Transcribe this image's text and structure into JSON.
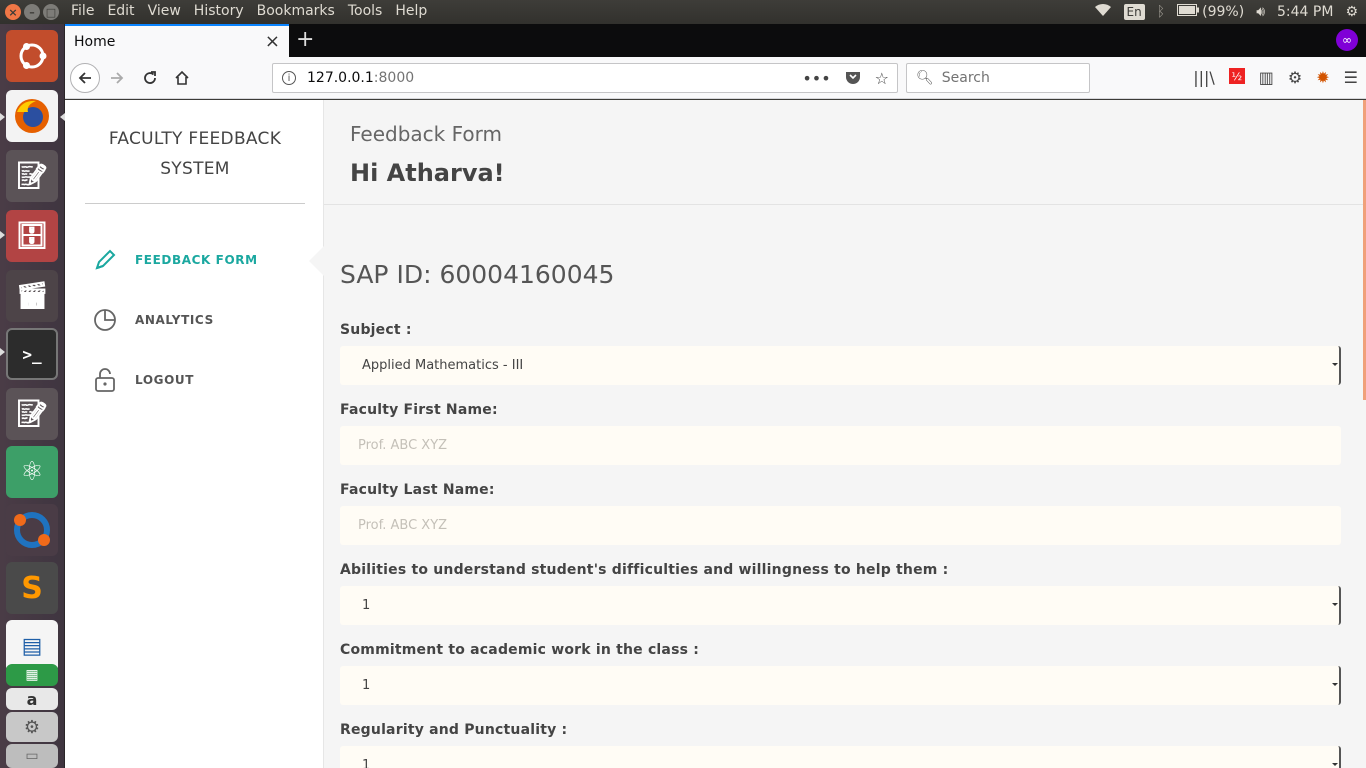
{
  "system_bar": {
    "menus": [
      "File",
      "Edit",
      "View",
      "History",
      "Bookmarks",
      "Tools",
      "Help"
    ],
    "keyboard": "En",
    "battery": "(99%)",
    "time": "5:44 PM"
  },
  "browser": {
    "tab_title": "Home",
    "url_host": "127.0.0.1",
    "url_port": ":8000",
    "search_placeholder": "Search"
  },
  "sidebar": {
    "brand": "FACULTY FEEDBACK SYSTEM",
    "items": [
      {
        "label": "FEEDBACK FORM",
        "icon": "pencil-icon",
        "active": true
      },
      {
        "label": "ANALYTICS",
        "icon": "pie-chart-icon",
        "active": false
      },
      {
        "label": "LOGOUT",
        "icon": "lock-icon",
        "active": false
      }
    ]
  },
  "header": {
    "subtitle": "Feedback Form",
    "greeting": "Hi Atharva!"
  },
  "form": {
    "sap_id": "SAP ID: 60004160045",
    "subject": {
      "label": "Subject :",
      "value": "Applied Mathematics - III"
    },
    "first_name": {
      "label": "Faculty First Name:",
      "placeholder": "Prof. ABC XYZ"
    },
    "last_name": {
      "label": "Faculty Last Name:",
      "placeholder": "Prof. ABC XYZ"
    },
    "q1": {
      "label": "Abilities to understand student's difficulties and willingness to help them :",
      "value": "1"
    },
    "q2": {
      "label": "Commitment to academic work in the class :",
      "value": "1"
    },
    "q3": {
      "label": "Regularity and Punctuality :",
      "value": "1"
    }
  },
  "colors": {
    "accent": "#1ba8a0",
    "field_bg": "#fffcf5",
    "content_bg": "#f5f5f5"
  }
}
